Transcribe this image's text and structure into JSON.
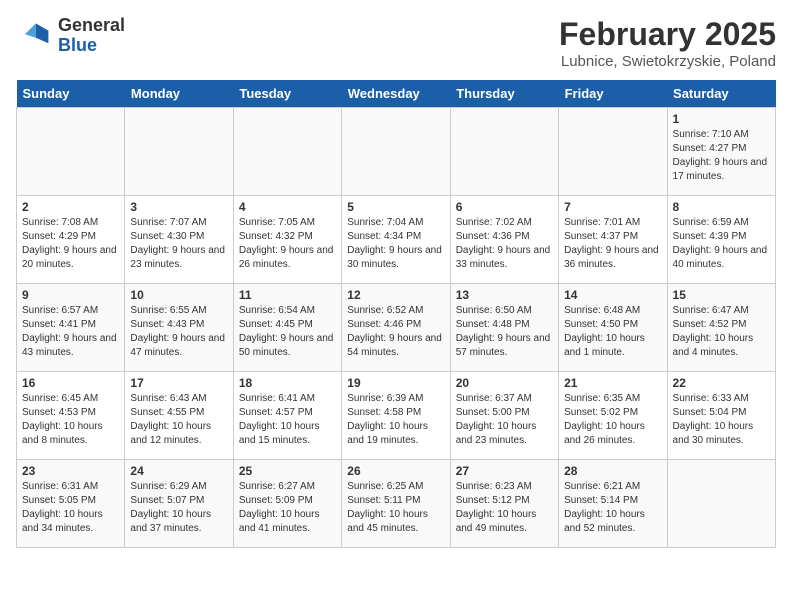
{
  "header": {
    "logo_line1": "General",
    "logo_line2": "Blue",
    "title": "February 2025",
    "subtitle": "Lubnice, Swietokrzyskie, Poland"
  },
  "days_of_week": [
    "Sunday",
    "Monday",
    "Tuesday",
    "Wednesday",
    "Thursday",
    "Friday",
    "Saturday"
  ],
  "weeks": [
    [
      {
        "day": "",
        "info": ""
      },
      {
        "day": "",
        "info": ""
      },
      {
        "day": "",
        "info": ""
      },
      {
        "day": "",
        "info": ""
      },
      {
        "day": "",
        "info": ""
      },
      {
        "day": "",
        "info": ""
      },
      {
        "day": "1",
        "info": "Sunrise: 7:10 AM\nSunset: 4:27 PM\nDaylight: 9 hours and 17 minutes."
      }
    ],
    [
      {
        "day": "2",
        "info": "Sunrise: 7:08 AM\nSunset: 4:29 PM\nDaylight: 9 hours and 20 minutes."
      },
      {
        "day": "3",
        "info": "Sunrise: 7:07 AM\nSunset: 4:30 PM\nDaylight: 9 hours and 23 minutes."
      },
      {
        "day": "4",
        "info": "Sunrise: 7:05 AM\nSunset: 4:32 PM\nDaylight: 9 hours and 26 minutes."
      },
      {
        "day": "5",
        "info": "Sunrise: 7:04 AM\nSunset: 4:34 PM\nDaylight: 9 hours and 30 minutes."
      },
      {
        "day": "6",
        "info": "Sunrise: 7:02 AM\nSunset: 4:36 PM\nDaylight: 9 hours and 33 minutes."
      },
      {
        "day": "7",
        "info": "Sunrise: 7:01 AM\nSunset: 4:37 PM\nDaylight: 9 hours and 36 minutes."
      },
      {
        "day": "8",
        "info": "Sunrise: 6:59 AM\nSunset: 4:39 PM\nDaylight: 9 hours and 40 minutes."
      }
    ],
    [
      {
        "day": "9",
        "info": "Sunrise: 6:57 AM\nSunset: 4:41 PM\nDaylight: 9 hours and 43 minutes."
      },
      {
        "day": "10",
        "info": "Sunrise: 6:55 AM\nSunset: 4:43 PM\nDaylight: 9 hours and 47 minutes."
      },
      {
        "day": "11",
        "info": "Sunrise: 6:54 AM\nSunset: 4:45 PM\nDaylight: 9 hours and 50 minutes."
      },
      {
        "day": "12",
        "info": "Sunrise: 6:52 AM\nSunset: 4:46 PM\nDaylight: 9 hours and 54 minutes."
      },
      {
        "day": "13",
        "info": "Sunrise: 6:50 AM\nSunset: 4:48 PM\nDaylight: 9 hours and 57 minutes."
      },
      {
        "day": "14",
        "info": "Sunrise: 6:48 AM\nSunset: 4:50 PM\nDaylight: 10 hours and 1 minute."
      },
      {
        "day": "15",
        "info": "Sunrise: 6:47 AM\nSunset: 4:52 PM\nDaylight: 10 hours and 4 minutes."
      }
    ],
    [
      {
        "day": "16",
        "info": "Sunrise: 6:45 AM\nSunset: 4:53 PM\nDaylight: 10 hours and 8 minutes."
      },
      {
        "day": "17",
        "info": "Sunrise: 6:43 AM\nSunset: 4:55 PM\nDaylight: 10 hours and 12 minutes."
      },
      {
        "day": "18",
        "info": "Sunrise: 6:41 AM\nSunset: 4:57 PM\nDaylight: 10 hours and 15 minutes."
      },
      {
        "day": "19",
        "info": "Sunrise: 6:39 AM\nSunset: 4:58 PM\nDaylight: 10 hours and 19 minutes."
      },
      {
        "day": "20",
        "info": "Sunrise: 6:37 AM\nSunset: 5:00 PM\nDaylight: 10 hours and 23 minutes."
      },
      {
        "day": "21",
        "info": "Sunrise: 6:35 AM\nSunset: 5:02 PM\nDaylight: 10 hours and 26 minutes."
      },
      {
        "day": "22",
        "info": "Sunrise: 6:33 AM\nSunset: 5:04 PM\nDaylight: 10 hours and 30 minutes."
      }
    ],
    [
      {
        "day": "23",
        "info": "Sunrise: 6:31 AM\nSunset: 5:05 PM\nDaylight: 10 hours and 34 minutes."
      },
      {
        "day": "24",
        "info": "Sunrise: 6:29 AM\nSunset: 5:07 PM\nDaylight: 10 hours and 37 minutes."
      },
      {
        "day": "25",
        "info": "Sunrise: 6:27 AM\nSunset: 5:09 PM\nDaylight: 10 hours and 41 minutes."
      },
      {
        "day": "26",
        "info": "Sunrise: 6:25 AM\nSunset: 5:11 PM\nDaylight: 10 hours and 45 minutes."
      },
      {
        "day": "27",
        "info": "Sunrise: 6:23 AM\nSunset: 5:12 PM\nDaylight: 10 hours and 49 minutes."
      },
      {
        "day": "28",
        "info": "Sunrise: 6:21 AM\nSunset: 5:14 PM\nDaylight: 10 hours and 52 minutes."
      },
      {
        "day": "",
        "info": ""
      }
    ]
  ]
}
